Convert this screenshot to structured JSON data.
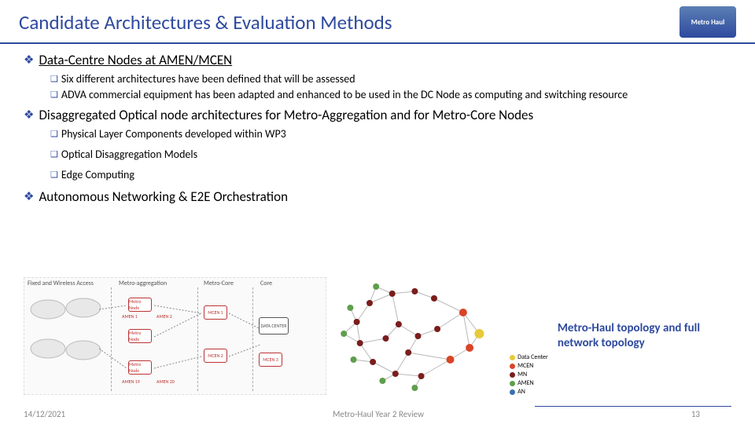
{
  "header": {
    "title": "Candidate Architectures & Evaluation Methods",
    "logo_text": "Metro Haul"
  },
  "sections": [
    {
      "label": "Data-Centre Nodes at AMEN/MCEN",
      "underline": true,
      "items": [
        "Six different architectures have been defined that will be assessed",
        "ADVA commercial equipment has been adapted and enhanced to be used in the DC Node as computing and switching resource"
      ]
    },
    {
      "label": "Disaggregated Optical node architectures for Metro-Aggregation and for Metro-Core Nodes",
      "underline": false,
      "items": [
        "Physical Layer Components developed within WP3",
        "Optical Disaggregation Models",
        "Edge Computing"
      ]
    },
    {
      "label": "Autonomous Networking & E2E Orchestration",
      "underline": false,
      "items": []
    }
  ],
  "diagram_left": {
    "col_labels": [
      "Fixed and Wireless Access",
      "Metro-aggregation",
      "Metro-Core",
      "Core"
    ],
    "node_labels": [
      "Metro Node",
      "Metro Node",
      "Metro Node",
      "MCEN 1",
      "MCEN 2",
      "DATA CENTER",
      "MCEN 3"
    ],
    "amen_labels": [
      "AMEN 1",
      "AMEN 2",
      "AMEN 19",
      "AMEN 20"
    ]
  },
  "caption": "Metro-Haul topology and full network topology",
  "legend": {
    "items": [
      {
        "label": "Data Center",
        "color": "#e8c93a"
      },
      {
        "label": "MCEN",
        "color": "#d94426"
      },
      {
        "label": "MN",
        "color": "#7a1d1d"
      },
      {
        "label": "AMEN",
        "color": "#5f9e4c"
      },
      {
        "label": "AN",
        "color": "#3a6fb0"
      }
    ]
  },
  "chart_data": {
    "type": "scatter",
    "title": "Network topology graph",
    "nodes": [
      {
        "id": "dc1",
        "kind": "Data Center",
        "x": 0.88,
        "y": 0.48
      },
      {
        "id": "mc1",
        "kind": "MCEN",
        "x": 0.78,
        "y": 0.3
      },
      {
        "id": "mc2",
        "kind": "MCEN",
        "x": 0.82,
        "y": 0.6
      },
      {
        "id": "mc3",
        "kind": "MCEN",
        "x": 0.7,
        "y": 0.7
      },
      {
        "id": "mn1",
        "kind": "MN",
        "x": 0.6,
        "y": 0.18
      },
      {
        "id": "mn2",
        "kind": "MN",
        "x": 0.48,
        "y": 0.12
      },
      {
        "id": "mn3",
        "kind": "MN",
        "x": 0.34,
        "y": 0.14
      },
      {
        "id": "mn4",
        "kind": "MN",
        "x": 0.2,
        "y": 0.22
      },
      {
        "id": "mn5",
        "kind": "MN",
        "x": 0.12,
        "y": 0.38
      },
      {
        "id": "mn6",
        "kind": "MN",
        "x": 0.14,
        "y": 0.56
      },
      {
        "id": "mn7",
        "kind": "MN",
        "x": 0.22,
        "y": 0.72
      },
      {
        "id": "mn8",
        "kind": "MN",
        "x": 0.36,
        "y": 0.82
      },
      {
        "id": "mn9",
        "kind": "MN",
        "x": 0.52,
        "y": 0.84
      },
      {
        "id": "mn10",
        "kind": "MN",
        "x": 0.38,
        "y": 0.4
      },
      {
        "id": "mn11",
        "kind": "MN",
        "x": 0.5,
        "y": 0.5
      },
      {
        "id": "mn12",
        "kind": "MN",
        "x": 0.62,
        "y": 0.44
      },
      {
        "id": "mn13",
        "kind": "MN",
        "x": 0.44,
        "y": 0.64
      },
      {
        "id": "mn14",
        "kind": "MN",
        "x": 0.3,
        "y": 0.52
      },
      {
        "id": "am1",
        "kind": "AMEN",
        "x": 0.08,
        "y": 0.26
      },
      {
        "id": "am2",
        "kind": "AMEN",
        "x": 0.04,
        "y": 0.48
      },
      {
        "id": "am3",
        "kind": "AMEN",
        "x": 0.1,
        "y": 0.7
      },
      {
        "id": "am4",
        "kind": "AMEN",
        "x": 0.28,
        "y": 0.88
      },
      {
        "id": "am5",
        "kind": "AMEN",
        "x": 0.48,
        "y": 0.94
      },
      {
        "id": "am6",
        "kind": "AMEN",
        "x": 0.24,
        "y": 0.08
      }
    ],
    "edges": [
      [
        "dc1",
        "mc1"
      ],
      [
        "dc1",
        "mc2"
      ],
      [
        "mc1",
        "mc2"
      ],
      [
        "mc2",
        "mc3"
      ],
      [
        "mc1",
        "mn1"
      ],
      [
        "mc1",
        "mn12"
      ],
      [
        "mc3",
        "mn9"
      ],
      [
        "mc3",
        "mn13"
      ],
      [
        "mn1",
        "mn2"
      ],
      [
        "mn2",
        "mn3"
      ],
      [
        "mn3",
        "mn4"
      ],
      [
        "mn4",
        "mn5"
      ],
      [
        "mn5",
        "mn6"
      ],
      [
        "mn6",
        "mn7"
      ],
      [
        "mn7",
        "mn8"
      ],
      [
        "mn8",
        "mn9"
      ],
      [
        "mn3",
        "mn10"
      ],
      [
        "mn10",
        "mn11"
      ],
      [
        "mn11",
        "mn12"
      ],
      [
        "mn11",
        "mn13"
      ],
      [
        "mn10",
        "mn14"
      ],
      [
        "mn14",
        "mn6"
      ],
      [
        "mn13",
        "mn8"
      ],
      [
        "mn5",
        "am1"
      ],
      [
        "mn5",
        "am2"
      ],
      [
        "mn6",
        "am2"
      ],
      [
        "mn7",
        "am3"
      ],
      [
        "mn8",
        "am4"
      ],
      [
        "mn9",
        "am5"
      ],
      [
        "mn4",
        "am6"
      ],
      [
        "mn3",
        "am6"
      ]
    ],
    "color_map": {
      "Data Center": "#e8c93a",
      "MCEN": "#d94426",
      "MN": "#7a1d1d",
      "AMEN": "#5f9e4c",
      "AN": "#3a6fb0"
    }
  },
  "footer": {
    "date": "14/12/2021",
    "center": "Metro-Haul Year 2 Review",
    "page": "13"
  }
}
